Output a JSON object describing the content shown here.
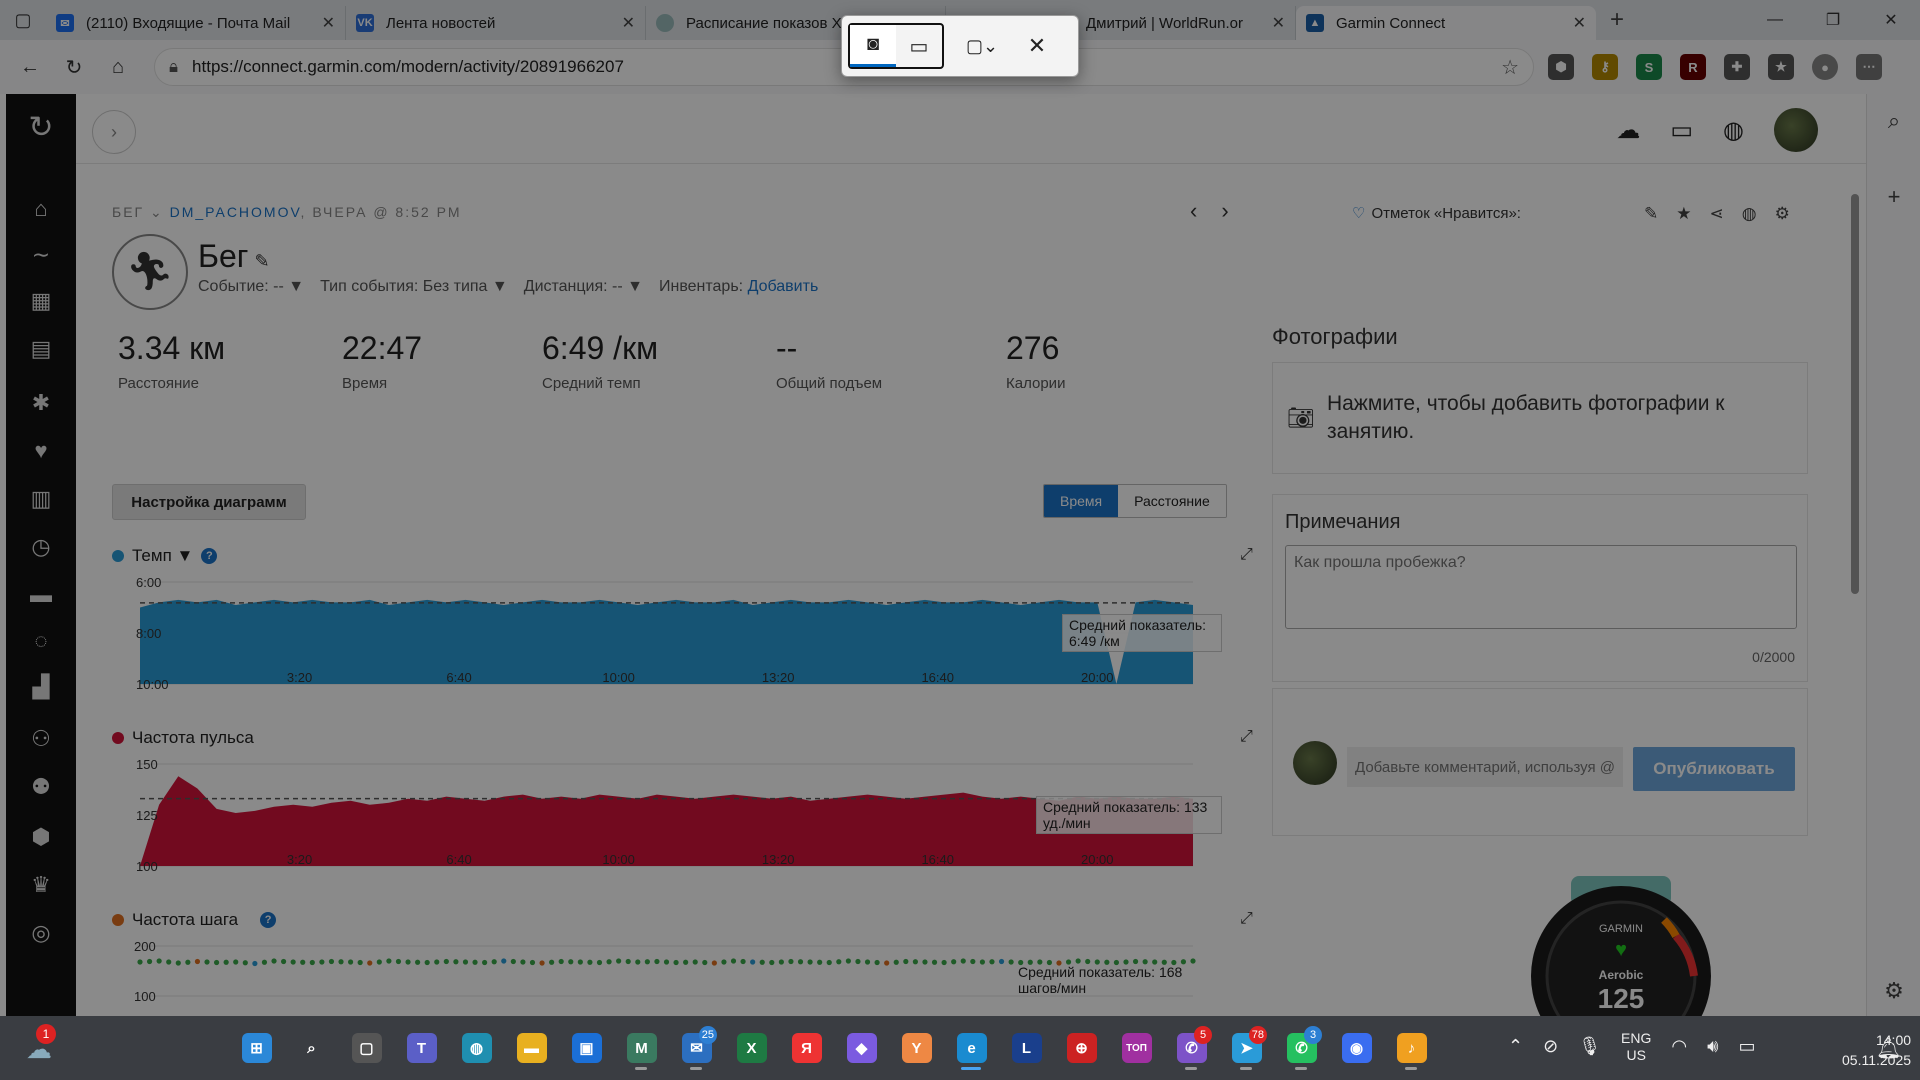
{
  "browser": {
    "tabs": [
      {
        "title": "(2110) Входящие - Почта Mail",
        "fav_color": "#1d6ff2",
        "fav_glyph": "✉"
      },
      {
        "title": "Лента новостей",
        "fav_color": "#2f6fd8",
        "fav_glyph": "VK"
      },
      {
        "title": "Расписание показов Х",
        "fav_color": "#9bb",
        "fav_glyph": "●"
      },
      {
        "title": "Дмитрий | WorldRun.or",
        "fav_color": "#3a3",
        "fav_glyph": "W"
      },
      {
        "title": "Garmin Connect",
        "fav_color": "#1b5fa6",
        "fav_glyph": "▲"
      }
    ],
    "url": "https://connect.garmin.com/modern/activity/20891966207"
  },
  "activity": {
    "breadcrumb_type": "БЕГ",
    "breadcrumb_user": "DM_PACHOMOV",
    "breadcrumb_time": "ВЧЕРА @ 8:52 PM",
    "likes_label": "Отметок «Нравится»:",
    "title": "Бег",
    "meta_event": "Событие: -- ▼",
    "meta_event_type": "Тип события: Без типа ▼",
    "meta_distance": "Дистанция: -- ▼",
    "meta_gear_label": "Инвентарь:",
    "meta_gear_link": "Добавить",
    "stats": [
      {
        "value": "3.34 км",
        "label": "Расстояние"
      },
      {
        "value": "22:47",
        "label": "Время"
      },
      {
        "value": "6:49 /км",
        "label": "Средний темп"
      },
      {
        "value": "--",
        "label": "Общий подъем"
      },
      {
        "value": "276",
        "label": "Калории"
      }
    ],
    "chart_settings_button": "Настройка диаграмм",
    "toggle_time": "Время",
    "toggle_distance": "Расстояние"
  },
  "charts": {
    "pace": {
      "title": "Темп ▼",
      "avg_label": "Средний показатель: 6:49 /км",
      "color": "#2a9bd6"
    },
    "hr": {
      "title": "Частота пульса",
      "avg_label": "Средний показатель: 133 уд./мин",
      "color": "#d2143a"
    },
    "cadence": {
      "title": "Частота шага",
      "avg_label": "Средний показатель: 168 шагов/мин",
      "color": "#e07020"
    }
  },
  "chart_data": [
    {
      "type": "area",
      "title": "Темп",
      "x": [
        "3:20",
        "6:40",
        "10:00",
        "13:20",
        "16:40",
        "20:00"
      ],
      "y_ticks": [
        "6:00",
        "8:00",
        "10:00"
      ],
      "ylim": [
        10,
        6
      ],
      "average": 6.82,
      "values": [
        7.0,
        6.8,
        6.7,
        6.8,
        6.7,
        6.9,
        6.8,
        6.7,
        6.8,
        6.7,
        6.8,
        6.8,
        6.7,
        6.9,
        6.8,
        6.7,
        6.8,
        6.7,
        6.8,
        6.9,
        6.8,
        6.7,
        6.8,
        6.8,
        6.7,
        6.8,
        6.9,
        6.8,
        6.7,
        6.8,
        6.8,
        6.7,
        6.9,
        6.8,
        6.7,
        6.8,
        6.8,
        6.7,
        6.8,
        6.9,
        6.8,
        6.7,
        6.8,
        6.8,
        6.7,
        6.8,
        6.9,
        6.8,
        6.7,
        6.8,
        6.8,
        10.0,
        6.8,
        6.7,
        6.8,
        6.9
      ]
    },
    {
      "type": "area",
      "title": "Частота пульса",
      "x": [
        "3:20",
        "6:40",
        "10:00",
        "13:20",
        "16:40",
        "20:00"
      ],
      "y_ticks": [
        "150",
        "125",
        "100"
      ],
      "ylim": [
        100,
        150
      ],
      "average": 133,
      "values": [
        100,
        130,
        144,
        138,
        128,
        126,
        127,
        129,
        130,
        129,
        131,
        132,
        130,
        131,
        133,
        132,
        134,
        133,
        132,
        134,
        135,
        133,
        134,
        133,
        135,
        134,
        133,
        135,
        134,
        133,
        134,
        135,
        134,
        133,
        134,
        132,
        133,
        134,
        135,
        134,
        133,
        134,
        135,
        136,
        134,
        133,
        134,
        133,
        132,
        134,
        133,
        134,
        133,
        133,
        134,
        133
      ]
    },
    {
      "type": "scatter",
      "title": "Частота шага",
      "y_ticks": [
        "200",
        "100"
      ],
      "ylim": [
        100,
        200
      ],
      "average": 168,
      "values": [
        168,
        170,
        166,
        169,
        167,
        168,
        165,
        170,
        168,
        167,
        169,
        168,
        166,
        170,
        168,
        167,
        169,
        168,
        167,
        170,
        168,
        166,
        169,
        168,
        167,
        170,
        168,
        169,
        167,
        168,
        166,
        170,
        168,
        167,
        169,
        168,
        167,
        170,
        168,
        166,
        169,
        168,
        167,
        170,
        168,
        169,
        167,
        168,
        166,
        170,
        168,
        167,
        169,
        168,
        167,
        170
      ]
    }
  ],
  "right": {
    "photos_heading": "Фотографии",
    "photos_prompt": "Нажмите, чтобы добавить фотографии к занятию.",
    "notes_heading": "Примечания",
    "notes_placeholder": "Как прошла пробежка?",
    "notes_count": "0/2000",
    "comment_placeholder": "Добавьте комментарий, используя @",
    "publish": "Опубликовать",
    "watch_brand": "GARMIN",
    "watch_mode": "Aerobic",
    "watch_value": "125"
  },
  "snip": {
    "photo_icon": "camera-icon",
    "video_icon": "video-icon"
  },
  "taskbar": {
    "weather_badge": "1",
    "apps": [
      {
        "name": "start-icon",
        "color": "#2b88d8",
        "glyph": "⊞",
        "count": ""
      },
      {
        "name": "search-icon",
        "color": "transparent",
        "glyph": "⌕",
        "count": ""
      },
      {
        "name": "taskview-icon",
        "color": "#555",
        "glyph": "▢",
        "count": ""
      },
      {
        "name": "teams-icon",
        "color": "#5b5fc7",
        "glyph": "T",
        "count": ""
      },
      {
        "name": "earth-icon",
        "color": "#1f8fb0",
        "glyph": "◍",
        "count": ""
      },
      {
        "name": "explorer-icon",
        "color": "#e8b020",
        "glyph": "▬",
        "count": ""
      },
      {
        "name": "store-icon",
        "color": "#1b6fd6",
        "glyph": "▣",
        "count": ""
      },
      {
        "name": "m365-icon",
        "color": "#3a7a60",
        "glyph": "M",
        "count": ""
      },
      {
        "name": "mail-icon",
        "color": "#2c6fc0",
        "glyph": "✉",
        "count": "25"
      },
      {
        "name": "excel-icon",
        "color": "#1e7a43",
        "glyph": "X",
        "count": ""
      },
      {
        "name": "yandex-icon",
        "color": "#e33",
        "glyph": "Я",
        "count": ""
      },
      {
        "name": "alice-icon",
        "color": "#7b5be0",
        "glyph": "◆",
        "count": ""
      },
      {
        "name": "ybrowser-icon",
        "color": "#e84",
        "glyph": "Y",
        "count": ""
      },
      {
        "name": "edge-icon",
        "color": "#1a8bd0",
        "glyph": "e",
        "count": ""
      },
      {
        "name": "l-icon",
        "color": "#1a3f8c",
        "glyph": "L",
        "count": ""
      },
      {
        "name": "antivirus-icon",
        "color": "#c22",
        "glyph": "⊕",
        "count": ""
      },
      {
        "name": "top-icon",
        "color": "#a030a0",
        "glyph": "ТОП",
        "count": ""
      },
      {
        "name": "viber-icon",
        "color": "#7d53c8",
        "glyph": "✆",
        "count": "5"
      },
      {
        "name": "telegram-icon",
        "color": "#2a9bd8",
        "glyph": "➤",
        "count": "78"
      },
      {
        "name": "whatsapp-icon",
        "color": "#25c060",
        "glyph": "✆",
        "count": "3"
      },
      {
        "name": "messenger-icon",
        "color": "#3a6df0",
        "glyph": "◉",
        "count": ""
      },
      {
        "name": "music-icon",
        "color": "#f0a020",
        "glyph": "♪",
        "count": ""
      }
    ],
    "lang_top": "ENG",
    "lang_bottom": "US",
    "time": "14:00",
    "date": "05.11.2025"
  }
}
